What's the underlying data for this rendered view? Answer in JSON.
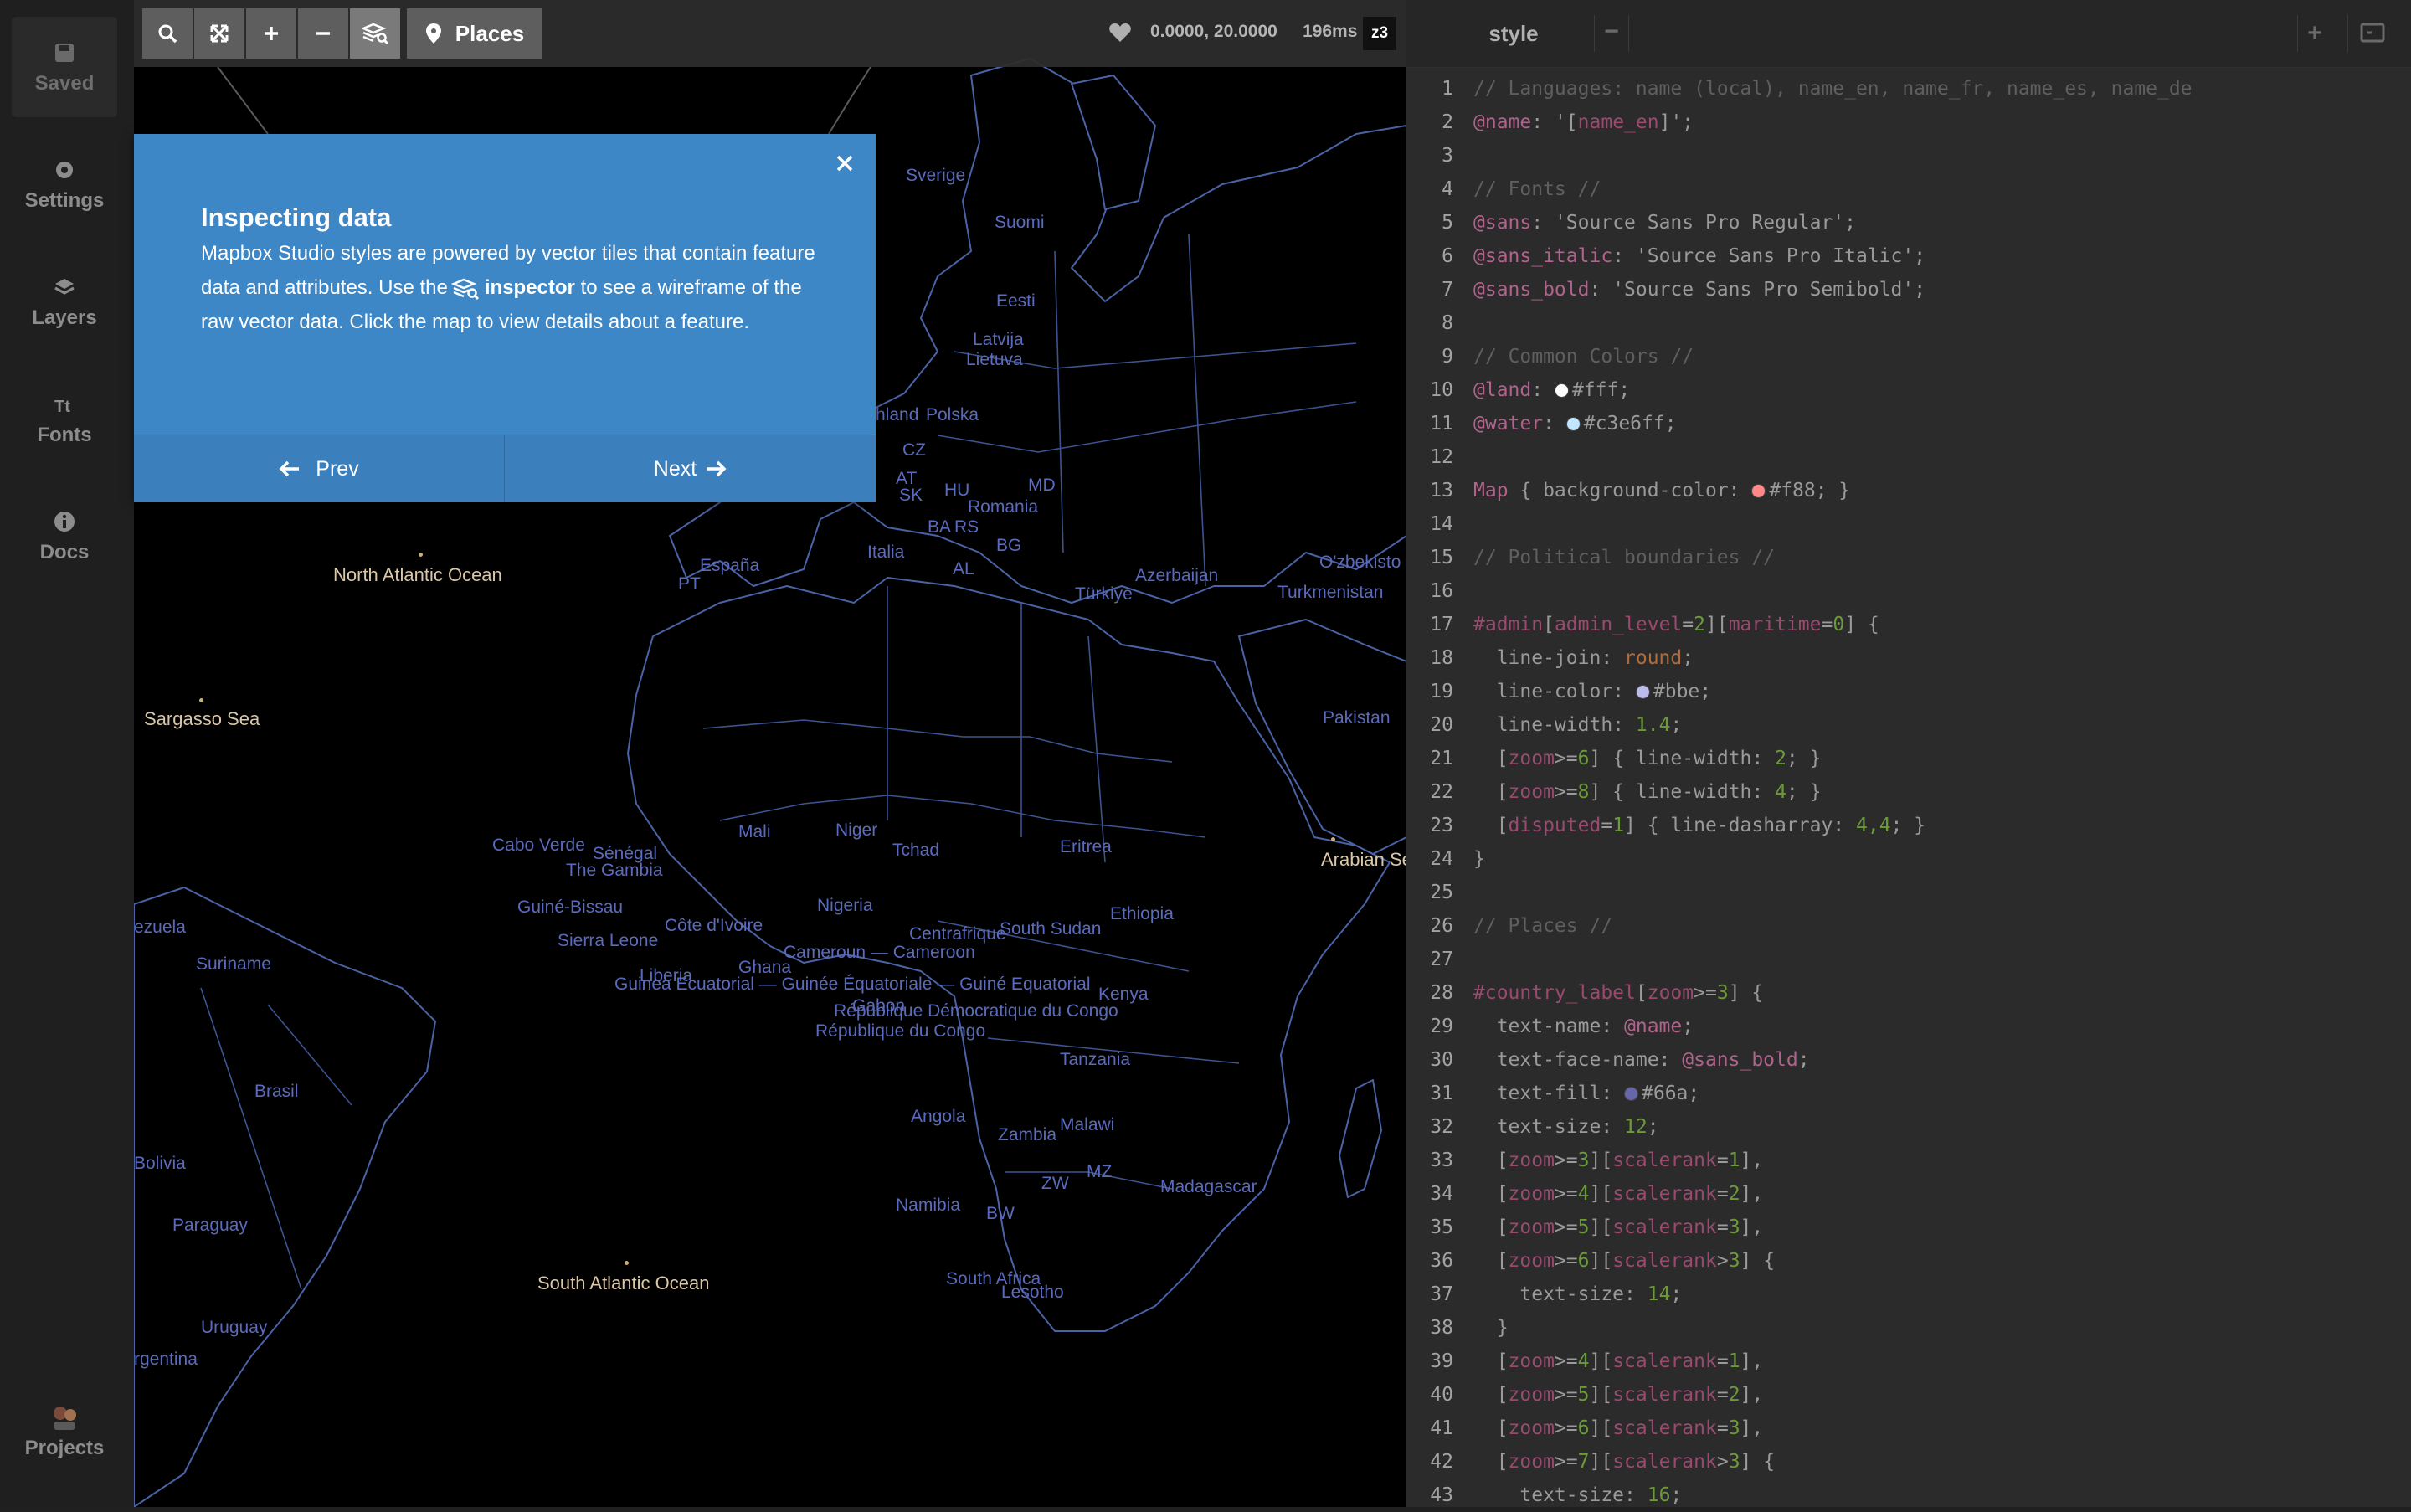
{
  "sidebar": {
    "items": [
      {
        "label": "Saved",
        "icon": "save-icon"
      },
      {
        "label": "Settings",
        "icon": "gear-icon"
      },
      {
        "label": "Layers",
        "icon": "layers-icon"
      },
      {
        "label": "Fonts",
        "icon": "fonts-icon"
      },
      {
        "label": "Docs",
        "icon": "info-icon"
      }
    ],
    "projects_label": "Projects"
  },
  "toolbar": {
    "places_label": "Places",
    "coordinates": "0.0000, 20.0000",
    "render_time": "196ms",
    "zoom": "z3"
  },
  "modal": {
    "title": "Inspecting data",
    "text_before": "Mapbox Studio styles are powered by vector tiles that contain feature data and attributes. Use the",
    "inspector_word": "inspector",
    "text_after": "to see a wireframe of the raw vector data. Click the map to view details about a feature.",
    "prev_label": "Prev",
    "next_label": "Next"
  },
  "map_labels": {
    "ocean": [
      "North Atlantic Ocean",
      "Sargasso Sea",
      "South Atlantic Ocean",
      "Arabian Se"
    ],
    "countries": [
      "Sverige",
      "Suomi",
      "Eesti",
      "Latvija",
      "Lietuva",
      "Polska",
      "hland",
      "CZ",
      "AT",
      "HU",
      "Romania",
      "SK",
      "MD",
      "BA",
      "RS",
      "BG",
      "España",
      "PT",
      "Italia",
      "AL",
      "Türkiye",
      "O'zbekisto",
      "Turkmenistan",
      "Pakistan",
      "Mali",
      "Niger",
      "Tchad",
      "Eritrea",
      "Cabo Verde",
      "Sénégal",
      "The Gambia",
      "Guiné-Bissau",
      "Nigeria",
      "Ethiopia",
      "Sierra Leone",
      "Côte d'Ivoire",
      "Centrafrique",
      "South Sudan",
      "Liberia",
      "Ghana",
      "Cameroun — Cameroon",
      "Guinea Ecuatorial — Guinée Équatoriale — Guiné Equatorial",
      "Kenya",
      "République Démocratique du Congo",
      "République du Congo",
      "Gabon",
      "Tanzania",
      "Brasil",
      "Suriname",
      "ezuela",
      "Angola",
      "Zambia",
      "Malawi",
      "Bolivia",
      "Paraguay",
      "Namibia",
      "ZW",
      "MZ",
      "BW",
      "Madagascar",
      "South Africa",
      "Lesotho",
      "Uruguay",
      "rgentina",
      "Azerbaijan"
    ]
  },
  "editor": {
    "tab_label": "style",
    "lines": [
      "// Languages: name (local), name_en, name_fr, name_es, name_de",
      "@name: '[name_en]';",
      "",
      "// Fonts //",
      "@sans: 'Source Sans Pro Regular';",
      "@sans_italic: 'Source Sans Pro Italic';",
      "@sans_bold: 'Source Sans Pro Semibold';",
      "",
      "// Common Colors //",
      "@land: #fff;",
      "@water: #c3e6ff;",
      "",
      "Map { background-color: #f88; }",
      "",
      "// Political boundaries //",
      "",
      "#admin[admin_level=2][maritime=0] {",
      "  line-join: round;",
      "  line-color: #bbe;",
      "  line-width: 1.4;",
      "  [zoom>=6] { line-width: 2; }",
      "  [zoom>=8] { line-width: 4; }",
      "  [disputed=1] { line-dasharray: 4,4; }",
      "}",
      "",
      "// Places //",
      "",
      "#country_label[zoom>=3] {",
      "  text-name: @name;",
      "  text-face-name: @sans_bold;",
      "  text-fill: #66a;",
      "  text-size: 12;",
      "  [zoom>=3][scalerank=1],",
      "  [zoom>=4][scalerank=2],",
      "  [zoom>=5][scalerank=3],",
      "  [zoom>=6][scalerank>3] {",
      "    text-size: 14;",
      "  }",
      "  [zoom>=4][scalerank=1],",
      "  [zoom>=5][scalerank=2],",
      "  [zoom>=6][scalerank=3],",
      "  [zoom>=7][scalerank>3] {",
      "    text-size: 16;"
    ],
    "swatches": {
      "land": "#ffffff",
      "water": "#c3e6ff",
      "background": "#ff8888",
      "line": "#bbbbee",
      "fill": "#6666aa"
    }
  },
  "colors": {
    "modal_bg": "#3e87c7",
    "map_bg": "#000000",
    "boundary": "#4a63a6",
    "editor_bg": "#2b2b2b"
  }
}
